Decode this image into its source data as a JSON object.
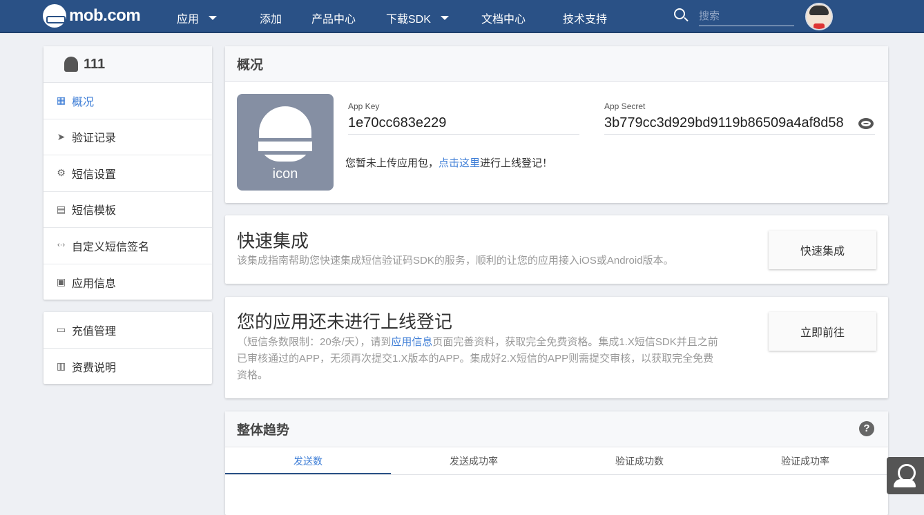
{
  "header": {
    "logo": "mob.com",
    "nav": [
      {
        "label": "应用",
        "dropdown": true
      },
      {
        "label": "添加"
      },
      {
        "label": "产品中心"
      },
      {
        "label": "下载SDK",
        "dropdown": true
      },
      {
        "label": "文档中心"
      },
      {
        "label": "技术支持"
      }
    ],
    "search_placeholder": "搜索"
  },
  "sidebar": {
    "app_name": "111",
    "items": [
      {
        "label": "概况",
        "icon": "dashboard-icon",
        "active": true
      },
      {
        "label": "验证记录",
        "icon": "send-icon"
      },
      {
        "label": "短信设置",
        "icon": "gear-icon"
      },
      {
        "label": "短信模板",
        "icon": "template-icon"
      },
      {
        "label": "自定义短信签名",
        "icon": "code-icon"
      },
      {
        "label": "应用信息",
        "icon": "app-info-icon"
      }
    ],
    "items2": [
      {
        "label": "充值管理",
        "icon": "credit-card-icon"
      },
      {
        "label": "资费说明",
        "icon": "clipboard-icon"
      }
    ]
  },
  "overview": {
    "title": "概况",
    "icon_text": "icon",
    "app_key_label": "App Key",
    "app_key": "1e70cc683e229",
    "app_secret_label": "App Secret",
    "app_secret": "3b779cc3d929bd9119b86509a4af8d58",
    "note_pre": "您暂未上传应用包，",
    "note_link": "点击这里",
    "note_post": "进行上线登记！"
  },
  "quick": {
    "title": "快速集成",
    "desc": "该集成指南帮助您快速集成短信验证码SDK的服务，顺利的让您的应用接入iOS或Android版本。",
    "button": "快速集成"
  },
  "register": {
    "title": "您的应用还未进行上线登记",
    "desc_pre": "（短信条数限制：20条/天），请到",
    "desc_link": "应用信息",
    "desc_post": "页面完善资料，获取完全免费资格。集成1.X短信SDK并且之前已审核通过的APP，无须再次提交1.X版本的APP。集成好2.X短信的APP则需提交审核，以获取完全免费资格。",
    "button": "立即前往"
  },
  "trend": {
    "title": "整体趋势",
    "help": "?",
    "tabs": [
      "发送数",
      "发送成功率",
      "验证成功数",
      "验证成功率"
    ],
    "active_tab": 0
  }
}
